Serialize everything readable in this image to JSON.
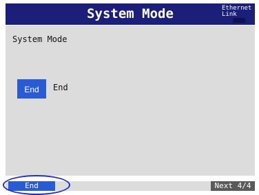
{
  "header": {
    "title": "System Mode",
    "ethernet_line1": "Ethernet",
    "ethernet_line2": "Link"
  },
  "main": {
    "section_label": "System Mode",
    "end_button_label": "End",
    "end_description": "End"
  },
  "footer": {
    "softkey_end_label": "End",
    "next_label": "Next 4/4"
  },
  "colors": {
    "title_bar": "#1b1f7a",
    "accent": "#2a5bd7",
    "panel_bg": "#dcdcdc"
  }
}
